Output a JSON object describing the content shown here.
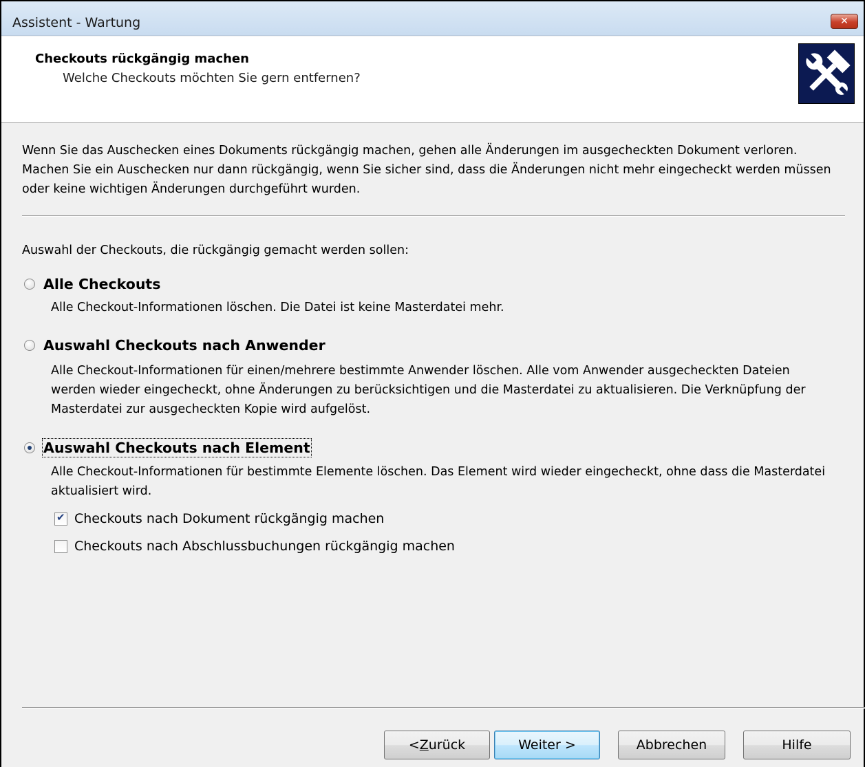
{
  "window": {
    "title": "Assistent - Wartung",
    "close_label": "✕"
  },
  "header": {
    "title": "Checkouts rückgängig machen",
    "subtitle": "Welche Checkouts möchten Sie gern entfernen?",
    "logo_icon": "tools-hammer-wrench-icon"
  },
  "intro_text": "Wenn Sie das Auschecken eines Dokuments rückgängig machen, gehen alle Änderungen im ausgecheckten Dokument verloren. Machen Sie ein Auschecken nur dann rückgängig, wenn Sie sicher sind, dass die Änderungen nicht mehr eingecheckt werden müssen oder keine wichtigen Änderungen durchgeführt wurden.",
  "selection_label": "Auswahl der Checkouts, die rückgängig gemacht werden sollen:",
  "options": [
    {
      "label": "Alle Checkouts",
      "description": "Alle Checkout-Informationen löschen. Die Datei ist keine Masterdatei mehr.",
      "checked": false
    },
    {
      "label": "Auswahl Checkouts nach Anwender",
      "description": "Alle Checkout-Informationen für einen/mehrere bestimmte Anwender löschen. Alle vom Anwender ausgecheckten Dateien werden wieder eingecheckt, ohne Änderungen zu berücksichtigen und die Masterdatei zu aktualisieren. Die Verknüpfung der Masterdatei zur ausgecheckten Kopie wird aufgelöst.",
      "checked": false
    },
    {
      "label": "Auswahl Checkouts nach Element",
      "description": "Alle Checkout-Informationen für bestimmte Elemente löschen. Das Element wird wieder eingecheckt, ohne dass die Masterdatei aktualisiert wird.",
      "checked": true
    }
  ],
  "checkboxes": [
    {
      "label": "Checkouts nach Dokument rückgängig machen",
      "checked": true
    },
    {
      "label": "Checkouts nach Abschlussbuchungen rückgängig machen",
      "checked": false
    }
  ],
  "buttons": {
    "back_prefix": "< ",
    "back_mnemonic": "Z",
    "back_rest": "urück",
    "next": "Weiter >",
    "cancel": "Abbrechen",
    "help": "Hilfe"
  },
  "colors": {
    "logo_bg": "#0c1a52",
    "close_red": "#c8402a",
    "default_button_border": "#3c7fb1"
  }
}
